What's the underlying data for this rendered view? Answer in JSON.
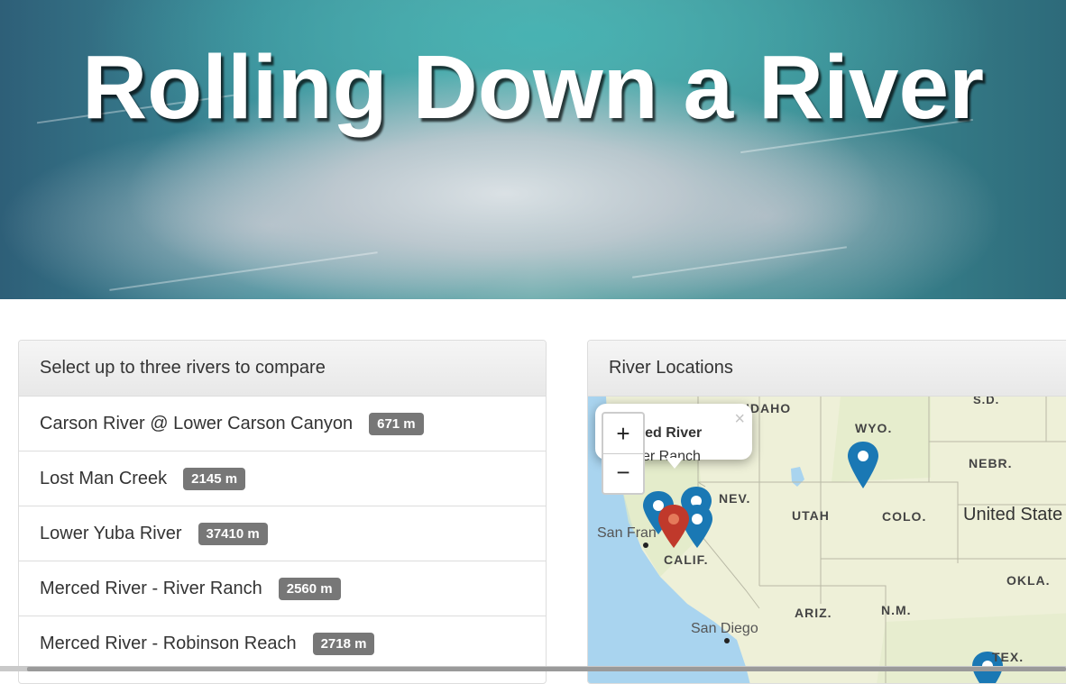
{
  "hero": {
    "title": "Rolling Down a River"
  },
  "left_panel": {
    "heading": "Select up to three rivers to compare",
    "rivers": [
      {
        "name": "Carson River @ Lower Carson Canyon",
        "length": "671 m"
      },
      {
        "name": "Lost Man Creek",
        "length": "2145 m"
      },
      {
        "name": "Lower Yuba River",
        "length": "37410 m"
      },
      {
        "name": "Merced River - River Ranch",
        "length": "2560 m"
      },
      {
        "name": "Merced River - Robinson Reach",
        "length": "2718 m"
      }
    ]
  },
  "right_panel": {
    "heading": "River Locations",
    "map": {
      "popup": {
        "title": "rced River",
        "subtitle": "er Ranch",
        "close": "×"
      },
      "zoom_in": "+",
      "zoom_out": "−",
      "labels": {
        "idaho": "IDAHO",
        "sd": "S.D.",
        "wyo": "WYO.",
        "nebr": "NEBR.",
        "nev": "NEV.",
        "utah": "UTAH",
        "colo": "COLO.",
        "us": "United State",
        "sf": "San Fran",
        "calif": "CALIF.",
        "okla": "OKLA.",
        "ariz": "ARIZ.",
        "nm": "N.M.",
        "sd_city": "San Diego",
        "tex": "TEX."
      },
      "colors": {
        "water": "#a9d4ef",
        "land": "#eef0d8",
        "marker_blue": "#1a78b4",
        "marker_red": "#c0392b"
      }
    }
  }
}
